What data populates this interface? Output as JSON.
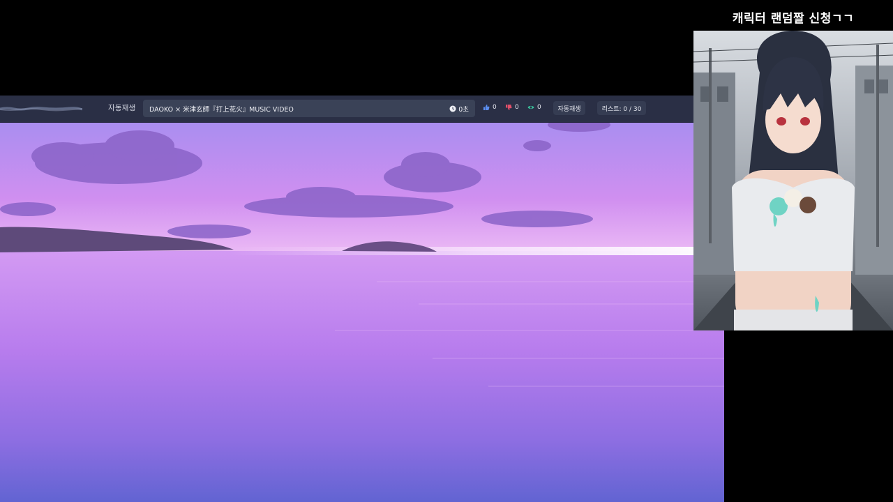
{
  "player": {
    "autoplay_label": "자동재생",
    "title": "DAOKO × 米津玄師『打上花火』MUSIC VIDEO",
    "time": "0초",
    "likes": "0",
    "dislikes": "0",
    "views": "0",
    "autoplay_button": "자동재생",
    "list_status": "리스트: 0 / 30"
  },
  "side_panel": {
    "title": "캐릭터 랜덤짤 신청ㄱㄱ"
  },
  "icons": {
    "clock": "clock-icon",
    "like": "thumbs-up-icon",
    "dislike": "thumbs-down-icon",
    "views": "eye-icon"
  },
  "colors": {
    "bar_bg": "#2a2f45",
    "field_bg": "#3a4257",
    "like": "#5b8def",
    "dislike": "#e2506a",
    "views": "#3cc9a0"
  }
}
